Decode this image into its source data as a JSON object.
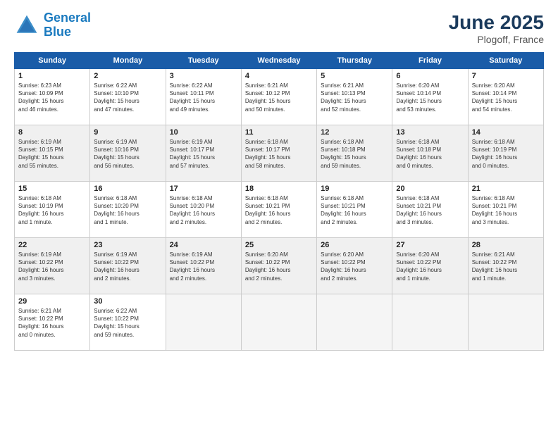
{
  "header": {
    "logo_line1": "General",
    "logo_line2": "Blue",
    "main_title": "June 2025",
    "subtitle": "Plogoff, France"
  },
  "days_of_week": [
    "Sunday",
    "Monday",
    "Tuesday",
    "Wednesday",
    "Thursday",
    "Friday",
    "Saturday"
  ],
  "weeks": [
    [
      {
        "num": "1",
        "info": "Sunrise: 6:23 AM\nSunset: 10:09 PM\nDaylight: 15 hours\nand 46 minutes.",
        "shade": false
      },
      {
        "num": "2",
        "info": "Sunrise: 6:22 AM\nSunset: 10:10 PM\nDaylight: 15 hours\nand 47 minutes.",
        "shade": false
      },
      {
        "num": "3",
        "info": "Sunrise: 6:22 AM\nSunset: 10:11 PM\nDaylight: 15 hours\nand 49 minutes.",
        "shade": false
      },
      {
        "num": "4",
        "info": "Sunrise: 6:21 AM\nSunset: 10:12 PM\nDaylight: 15 hours\nand 50 minutes.",
        "shade": false
      },
      {
        "num": "5",
        "info": "Sunrise: 6:21 AM\nSunset: 10:13 PM\nDaylight: 15 hours\nand 52 minutes.",
        "shade": false
      },
      {
        "num": "6",
        "info": "Sunrise: 6:20 AM\nSunset: 10:14 PM\nDaylight: 15 hours\nand 53 minutes.",
        "shade": false
      },
      {
        "num": "7",
        "info": "Sunrise: 6:20 AM\nSunset: 10:14 PM\nDaylight: 15 hours\nand 54 minutes.",
        "shade": false
      }
    ],
    [
      {
        "num": "8",
        "info": "Sunrise: 6:19 AM\nSunset: 10:15 PM\nDaylight: 15 hours\nand 55 minutes.",
        "shade": true
      },
      {
        "num": "9",
        "info": "Sunrise: 6:19 AM\nSunset: 10:16 PM\nDaylight: 15 hours\nand 56 minutes.",
        "shade": true
      },
      {
        "num": "10",
        "info": "Sunrise: 6:19 AM\nSunset: 10:17 PM\nDaylight: 15 hours\nand 57 minutes.",
        "shade": true
      },
      {
        "num": "11",
        "info": "Sunrise: 6:18 AM\nSunset: 10:17 PM\nDaylight: 15 hours\nand 58 minutes.",
        "shade": true
      },
      {
        "num": "12",
        "info": "Sunrise: 6:18 AM\nSunset: 10:18 PM\nDaylight: 15 hours\nand 59 minutes.",
        "shade": true
      },
      {
        "num": "13",
        "info": "Sunrise: 6:18 AM\nSunset: 10:18 PM\nDaylight: 16 hours\nand 0 minutes.",
        "shade": true
      },
      {
        "num": "14",
        "info": "Sunrise: 6:18 AM\nSunset: 10:19 PM\nDaylight: 16 hours\nand 0 minutes.",
        "shade": true
      }
    ],
    [
      {
        "num": "15",
        "info": "Sunrise: 6:18 AM\nSunset: 10:19 PM\nDaylight: 16 hours\nand 1 minute.",
        "shade": false
      },
      {
        "num": "16",
        "info": "Sunrise: 6:18 AM\nSunset: 10:20 PM\nDaylight: 16 hours\nand 1 minute.",
        "shade": false
      },
      {
        "num": "17",
        "info": "Sunrise: 6:18 AM\nSunset: 10:20 PM\nDaylight: 16 hours\nand 2 minutes.",
        "shade": false
      },
      {
        "num": "18",
        "info": "Sunrise: 6:18 AM\nSunset: 10:21 PM\nDaylight: 16 hours\nand 2 minutes.",
        "shade": false
      },
      {
        "num": "19",
        "info": "Sunrise: 6:18 AM\nSunset: 10:21 PM\nDaylight: 16 hours\nand 2 minutes.",
        "shade": false
      },
      {
        "num": "20",
        "info": "Sunrise: 6:18 AM\nSunset: 10:21 PM\nDaylight: 16 hours\nand 3 minutes.",
        "shade": false
      },
      {
        "num": "21",
        "info": "Sunrise: 6:18 AM\nSunset: 10:21 PM\nDaylight: 16 hours\nand 3 minutes.",
        "shade": false
      }
    ],
    [
      {
        "num": "22",
        "info": "Sunrise: 6:19 AM\nSunset: 10:22 PM\nDaylight: 16 hours\nand 3 minutes.",
        "shade": true
      },
      {
        "num": "23",
        "info": "Sunrise: 6:19 AM\nSunset: 10:22 PM\nDaylight: 16 hours\nand 2 minutes.",
        "shade": true
      },
      {
        "num": "24",
        "info": "Sunrise: 6:19 AM\nSunset: 10:22 PM\nDaylight: 16 hours\nand 2 minutes.",
        "shade": true
      },
      {
        "num": "25",
        "info": "Sunrise: 6:20 AM\nSunset: 10:22 PM\nDaylight: 16 hours\nand 2 minutes.",
        "shade": true
      },
      {
        "num": "26",
        "info": "Sunrise: 6:20 AM\nSunset: 10:22 PM\nDaylight: 16 hours\nand 2 minutes.",
        "shade": true
      },
      {
        "num": "27",
        "info": "Sunrise: 6:20 AM\nSunset: 10:22 PM\nDaylight: 16 hours\nand 1 minute.",
        "shade": true
      },
      {
        "num": "28",
        "info": "Sunrise: 6:21 AM\nSunset: 10:22 PM\nDaylight: 16 hours\nand 1 minute.",
        "shade": true
      }
    ],
    [
      {
        "num": "29",
        "info": "Sunrise: 6:21 AM\nSunset: 10:22 PM\nDaylight: 16 hours\nand 0 minutes.",
        "shade": false
      },
      {
        "num": "30",
        "info": "Sunrise: 6:22 AM\nSunset: 10:22 PM\nDaylight: 15 hours\nand 59 minutes.",
        "shade": false
      },
      {
        "num": "",
        "info": "",
        "shade": true,
        "empty": true
      },
      {
        "num": "",
        "info": "",
        "shade": true,
        "empty": true
      },
      {
        "num": "",
        "info": "",
        "shade": true,
        "empty": true
      },
      {
        "num": "",
        "info": "",
        "shade": true,
        "empty": true
      },
      {
        "num": "",
        "info": "",
        "shade": true,
        "empty": true
      }
    ]
  ]
}
